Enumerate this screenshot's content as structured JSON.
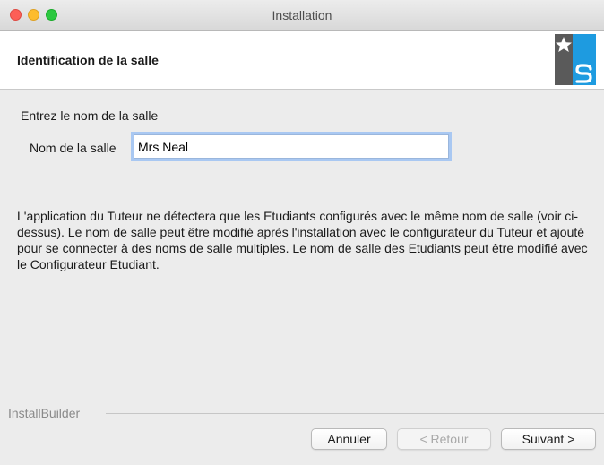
{
  "window": {
    "title": "Installation"
  },
  "header": {
    "title": "Identification de la salle"
  },
  "form": {
    "prompt": "Entrez le nom de la salle",
    "field_label": "Nom de la salle",
    "field_value": "Mrs Neal",
    "info_text": "L'application du Tuteur ne détectera que les Etudiants configurés avec le même nom de salle (voir ci-dessus).  Le nom de salle peut être modifié après l'installation avec le configurateur du Tuteur et ajouté pour se connecter à des noms de salle multiples.  Le nom de salle des Etudiants peut être modifié avec le Configurateur Etudiant."
  },
  "footer": {
    "brand": "InstallBuilder",
    "cancel_label": "Annuler",
    "back_label": "< Retour",
    "next_label": "Suivant >"
  },
  "colors": {
    "close": "#fc5f57",
    "minimize": "#fdbc2e",
    "maximize": "#2cc840",
    "logo_blue": "#1e9be0",
    "logo_dark": "#5a5a5a"
  },
  "icons": {
    "logo": "star-s-logo-icon"
  }
}
